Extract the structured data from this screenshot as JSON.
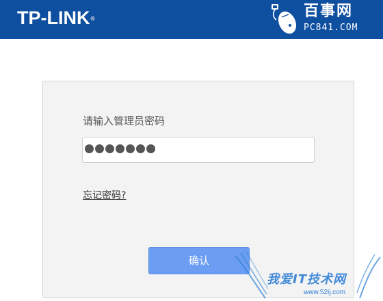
{
  "header": {
    "brand": "TP-LINK",
    "brand_mark": "®",
    "background_color": "#0f4fa0"
  },
  "watermark_top": {
    "cn": "百事网",
    "url": "PC841.COM",
    "icon": "mouse-icon"
  },
  "login": {
    "prompt": "请输入管理员密码",
    "password_length": 7,
    "forgot_label": "忘记密码?",
    "confirm_label": "确认",
    "button_color": "#6b9ef2"
  },
  "watermark_bottom": {
    "cn": "我爱IT技术网",
    "url": "www.52ij.com",
    "icon": "wings-icon"
  }
}
